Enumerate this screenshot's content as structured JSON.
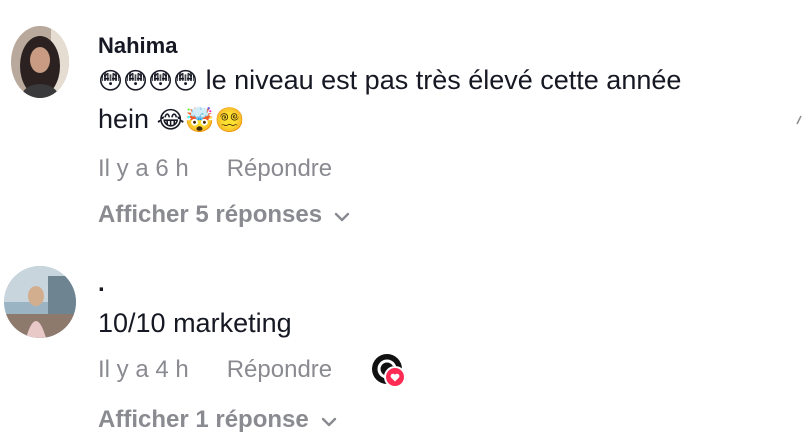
{
  "comments": [
    {
      "username": "Nahima",
      "text_line1": " le niveau est pas très élevé cette année",
      "text_line1_emoji": "😳😳😳😳",
      "text_line2": "hein ",
      "text_line2_emoji": "😂🤯😵‍💫",
      "time": "Il y a 6 h",
      "reply_label": "Répondre",
      "view_replies_label": "Afficher 5 réponses"
    },
    {
      "username": ".",
      "text": "10/10 marketing",
      "time": "Il y a 4 h",
      "reply_label": "Répondre",
      "view_replies_label": "Afficher 1 réponse",
      "creator_liked": true
    }
  ],
  "icons": {
    "chevron": "chevron-down-icon",
    "heart": "heart-icon"
  },
  "colors": {
    "secondary_text": "#8a8b91",
    "heart": "#fe2c55"
  }
}
